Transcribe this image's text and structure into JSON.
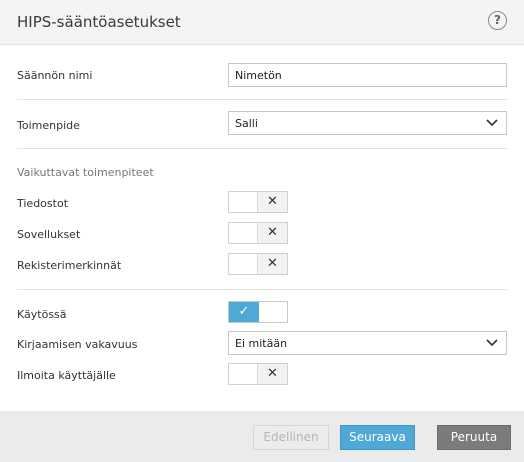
{
  "window": {
    "title": "HIPS-sääntöasetukset",
    "help_glyph": "?"
  },
  "form": {
    "rule_name": {
      "label": "Säännön nimi",
      "value": "Nimetön"
    },
    "action": {
      "label": "Toimenpide",
      "value": "Salli"
    },
    "affected_section": "Vaikuttavat toimenpiteet",
    "files": {
      "label": "Tiedostot",
      "enabled": false
    },
    "applications": {
      "label": "Sovellukset",
      "enabled": false
    },
    "registry": {
      "label": "Rekisterimerkinnät",
      "enabled": false
    },
    "enabled": {
      "label": "Käytössä",
      "enabled": true
    },
    "logging": {
      "label": "Kirjaamisen vakavuus",
      "value": "Ei mitään"
    },
    "notify": {
      "label": "Ilmoita käyttäjälle",
      "enabled": false
    }
  },
  "toggle_glyphs": {
    "off": "✕",
    "on": "✓"
  },
  "buttons": {
    "previous": "Edellinen",
    "next": "Seuraava",
    "cancel": "Peruuta"
  },
  "colors": {
    "accent": "#4fa8d6",
    "cancel": "#7b7b7b"
  }
}
